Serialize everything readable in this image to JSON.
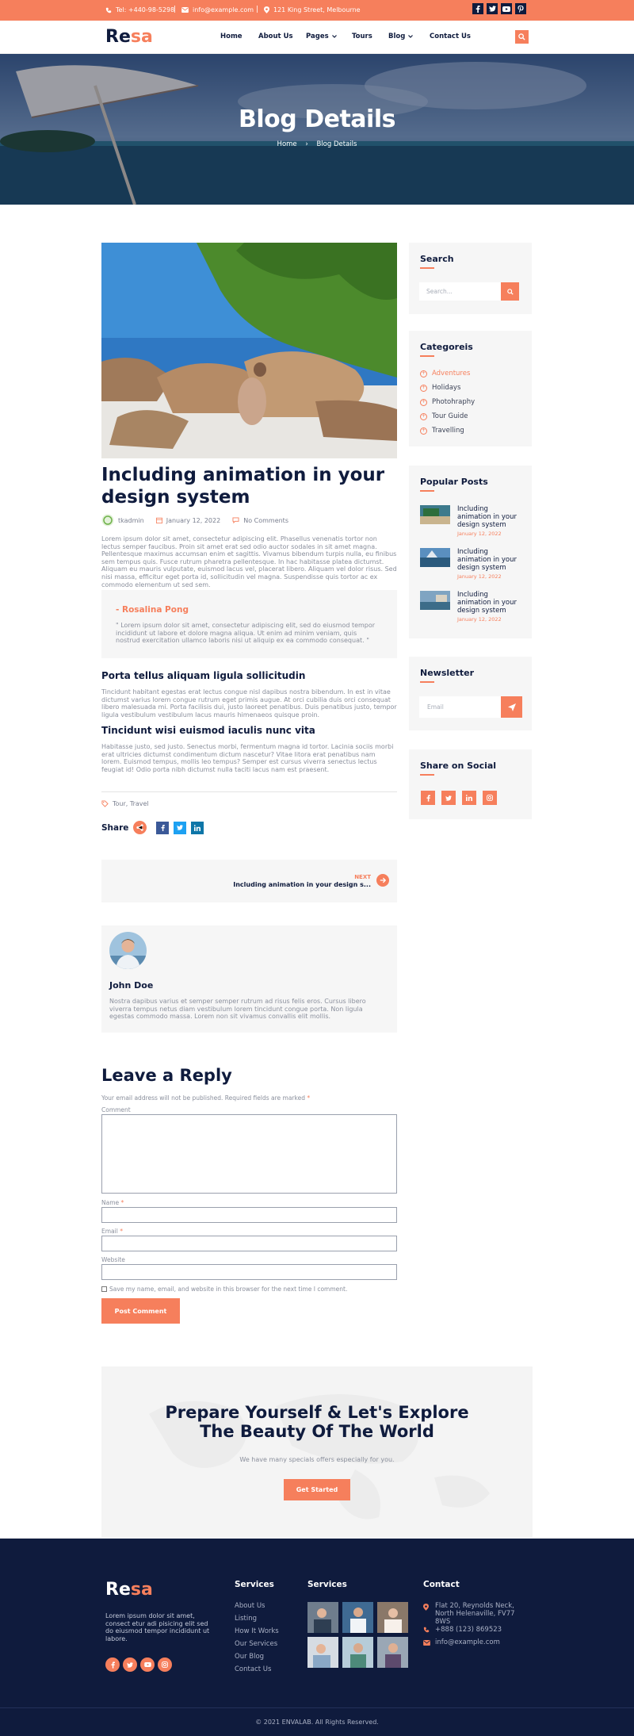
{
  "topbar": {
    "phone": "Tel: +440-98-5298",
    "email": "info@example.com",
    "address": "121 King Street, Melbourne",
    "social_icons": [
      "facebook-icon",
      "twitter-icon",
      "youtube-icon",
      "pinterest-icon"
    ]
  },
  "brand": {
    "logo_dark": "Re",
    "logo_accent": "sa",
    "accent_color": "#f67f5c",
    "navy_color": "#0f1b3d"
  },
  "nav": {
    "items": [
      "Home",
      "About Us",
      "Pages",
      "Tours",
      "Blog",
      "Contact Us"
    ]
  },
  "hero": {
    "title": "Blog Details",
    "breadcrumb_home": "Home",
    "breadcrumb_sep": "›",
    "breadcrumb_current": "Blog Details"
  },
  "post": {
    "title": "Including animation in your design system",
    "author": "tkadmin",
    "date": "January 12, 2022",
    "comments": "No Comments",
    "intro": "Lorem ipsum dolor sit amet, consectetur adipiscing elit. Phasellus venenatis tortor non lectus semper faucibus. Proin sit amet erat sed odio auctor sodales in sit amet magna. Pellentesque maximus accumsan enim et sagittis. Vivamus bibendum turpis nulla, eu finibus sem tempus quis. Fusce rutrum pharetra pellentesque. In hac habitasse platea dictumst. Aliquam eu mauris vulputate, euismod lacus vel, placerat libero. Aliquam vel dolor risus. Sed nisi massa, efficitur eget porta id, sollicitudin vel magna. Suspendisse quis tortor ac ex commodo elementum ut sed sem.",
    "quote_name": "- Rosalina Pong",
    "quote_text": "\" Lorem ipsum dolor sit amet, consectetur adipiscing elit, sed do eiusmod tempor incididunt ut labore et dolore magna aliqua. Ut enim ad minim veniam, quis nostrud exercitation ullamco laboris nisi ut aliquip ex ea commodo consequat. \"",
    "h1": "Porta tellus aliquam ligula sollicitudin",
    "p1": "Tincidunt habitant egestas erat lectus congue nisl dapibus nostra bibendum. In est in vitae dictumst varius lorem congue rutrum eget primis augue. At orci cubilia duis orci consequat libero malesuada mi. Porta facilisis dui, justo laoreet penatibus. Duis penatibus justo, tempor ligula vestibulum vestibulum lacus mauris himenaeos quisque proin.",
    "h2": "Tincidunt wisi euismod iaculis nunc vita",
    "p2": "Habitasse justo, sed justo. Senectus morbi, fermentum magna id tortor. Lacinia sociis morbi erat ultricies dictumst condimentum dictum nascetur? Vitae litora erat penatibus nam lorem. Euismod tempus, mollis leo tempus? Semper est cursus viverra senectus lectus feugiat id! Odio porta nibh dictumst nulla taciti lacus nam est praesent.",
    "tags": "Tour, Travel",
    "share_label": "Share",
    "next_label": "NEXT",
    "next_title": "Including animation in your design s..."
  },
  "author_box": {
    "name": "John Doe",
    "bio": "Nostra dapibus varius et semper semper rutrum ad risus felis eros. Cursus libero viverra tempus netus diam vestibulum lorem tincidunt congue porta. Non ligula egestas commodo massa. Lorem non sit vivamus convallis elit mollis."
  },
  "reply": {
    "title": "Leave a Reply",
    "notice": "Your email address will not be published.",
    "required": "Required fields are marked",
    "star": "*",
    "comment_label": "Comment",
    "name_label": "Name",
    "email_label": "Email",
    "website_label": "Website",
    "save_label": "Save my name, email, and website in this browser for the next time I comment.",
    "submit": "Post Comment"
  },
  "sidebar": {
    "search_title": "Search",
    "search_placeholder": "Search...",
    "categories_title": "Categoreis",
    "categories": [
      "Adventures",
      "Holidays",
      "Photohraphy",
      "Tour Guide",
      "Travelling"
    ],
    "popular_title": "Popular Posts",
    "popular_posts": [
      {
        "title": "Including animation in your design system",
        "date": "January 12, 2022"
      },
      {
        "title": "Including animation in your design system",
        "date": "January 12, 2022"
      },
      {
        "title": "Including animation in your design system",
        "date": "January 12, 2022"
      }
    ],
    "newsletter_title": "Newsletter",
    "newsletter_placeholder": "Email",
    "social_title": "Share on Social"
  },
  "cta": {
    "title_line1": "Prepare Yourself & Let's Explore",
    "title_line2": "The Beauty Of The World",
    "subtitle": "We have many specials offers especially for you.",
    "button": "Get Started"
  },
  "footer": {
    "about": "Lorem ipsum dolor sit amet, consect etur adi pisicing elit sed do eiusmod tempor incididunt ut labore.",
    "services_title": "Services",
    "services_links": [
      "About Us",
      "Listing",
      "How It Works",
      "Our Services",
      "Our Blog",
      "Contact Us"
    ],
    "gallery_title": "Services",
    "contact_title": "Contact",
    "address": "Flat 20, Reynolds Neck, North Helenaville, FV77 8WS",
    "phone": "+888 (123) 869523",
    "email": "info@example.com",
    "copyright": "© 2021 ENVALAB. All Rights Reserved."
  }
}
